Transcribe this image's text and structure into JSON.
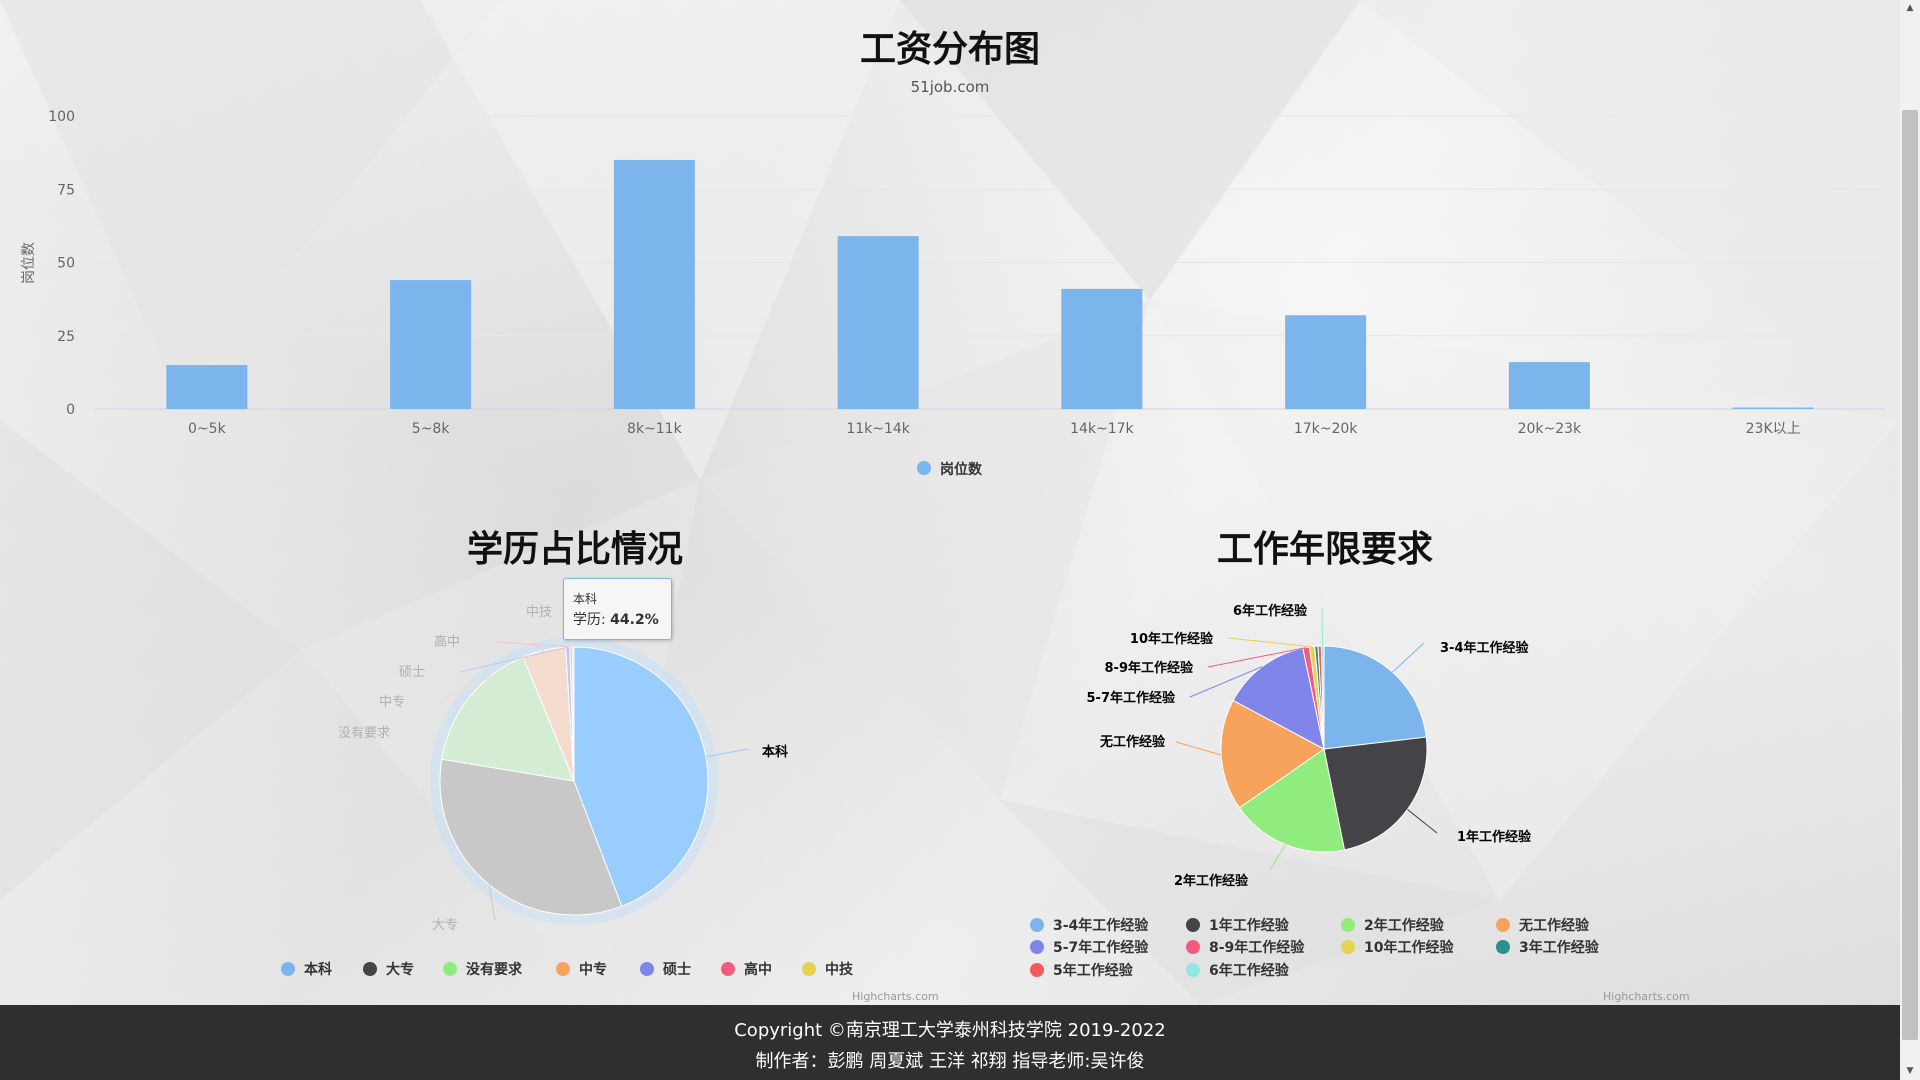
{
  "bar_chart": {
    "title": "工资分布图",
    "subtitle": "51job.com",
    "credits": "Highcharts.com"
  },
  "edu_chart": {
    "title": "学历占比情况",
    "tooltip": {
      "name": "本科",
      "series": "学历",
      "value": "44.2%"
    },
    "credits": "Highcharts.com"
  },
  "exp_chart": {
    "title": "工作年限要求",
    "credits": "Highcharts.com"
  },
  "footer": {
    "line1": "Copyright ©南京理工大学泰州科技学院 2019-2022",
    "line2": "制作者：彭鹏 周夏斌 王洋 祁翔 指导老师:吴许俊"
  },
  "chart_data": [
    {
      "type": "bar",
      "title": "工资分布图",
      "subtitle": "51job.com",
      "categories": [
        "0~5k",
        "5~8k",
        "8k~11k",
        "11k~14k",
        "14k~17k",
        "17k~20k",
        "20k~23k",
        "23K以上"
      ],
      "series": [
        {
          "name": "岗位数",
          "values": [
            15,
            44,
            85,
            59,
            41,
            32,
            16,
            0.5
          ],
          "color": "#7cb5ec"
        }
      ],
      "ylabel": "岗位数",
      "ylim": [
        0,
        100
      ],
      "yticks": [
        0,
        25,
        50,
        75,
        100
      ],
      "grid": true,
      "legend": "bottom-center"
    },
    {
      "type": "pie",
      "title": "学历占比情况",
      "series_name": "学历",
      "slices": [
        {
          "name": "本科",
          "value": 44.2,
          "color": "#99ccff"
        },
        {
          "name": "大专",
          "value": 33.4,
          "color": "#c8c8c8"
        },
        {
          "name": "没有要求",
          "value": 16.2,
          "color": "#d5ecd4"
        },
        {
          "name": "中专",
          "value": 5.2,
          "color": "#f3dccd"
        },
        {
          "name": "硕士",
          "value": 0.5,
          "color": "#c4c6ee"
        },
        {
          "name": "高中",
          "value": 0.3,
          "color": "#f3c4cc"
        },
        {
          "name": "中技",
          "value": 0.2,
          "color": "#ede3b8"
        }
      ],
      "legend_colors": [
        "#7cb5ec",
        "#434348",
        "#90ed7d",
        "#f7a35c",
        "#8085e9",
        "#f15c80",
        "#e4d354"
      ],
      "legend": "bottom-center"
    },
    {
      "type": "pie",
      "title": "工作年限要求",
      "slices": [
        {
          "name": "3-4年工作经验",
          "value": 22.5,
          "color": "#7cb5ec"
        },
        {
          "name": "1年工作经验",
          "value": 23.0,
          "color": "#434348"
        },
        {
          "name": "2年工作经验",
          "value": 18.0,
          "color": "#90ed7d"
        },
        {
          "name": "无工作经验",
          "value": 17.0,
          "color": "#f7a35c"
        },
        {
          "name": "5-7年工作经验",
          "value": 13.5,
          "color": "#8085e9"
        },
        {
          "name": "8-9年工作经验",
          "value": 1.0,
          "color": "#f15c80"
        },
        {
          "name": "10年工作经验",
          "value": 0.8,
          "color": "#e4d354"
        },
        {
          "name": "3年工作经验",
          "value": 0.5,
          "color": "#2b908f"
        },
        {
          "name": "5年工作经验",
          "value": 0.5,
          "color": "#f45b5b"
        },
        {
          "name": "6年工作经验",
          "value": 0.4,
          "color": "#91e8e1"
        }
      ],
      "legend": "bottom-center"
    }
  ]
}
